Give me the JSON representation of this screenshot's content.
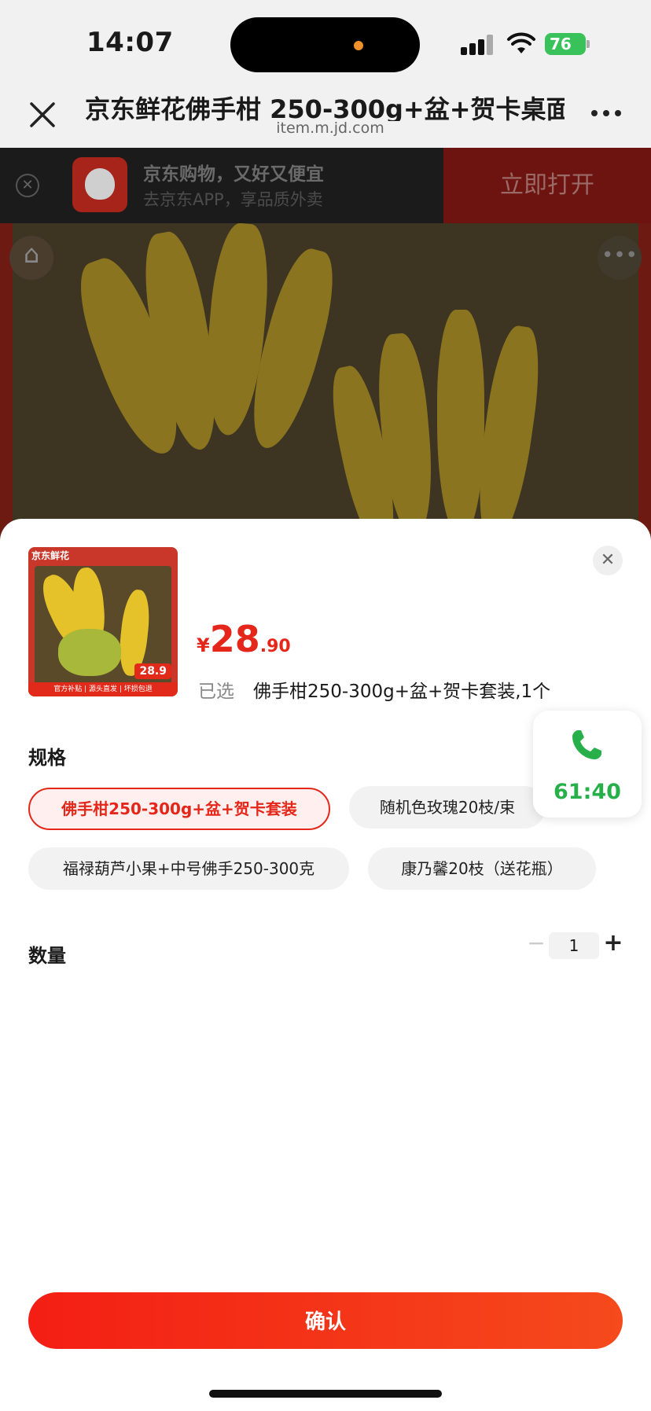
{
  "status_bar": {
    "time": "14:07",
    "battery": "76"
  },
  "browser": {
    "title": "京东鲜花佛手柑 250-300g+盆+贺卡桌面",
    "url": "item.m.jd.com"
  },
  "app_banner": {
    "title": "京东购物，又好又便宜",
    "subtitle": "去京东APP，享品质外卖",
    "open_label": "立即打开"
  },
  "product": {
    "thumb_brand": "京东鲜花",
    "thumb_price": "28.9",
    "thumb_footer": "官方补贴 | 源头直发 | 坏损包退",
    "price_currency": "¥",
    "price_int": "28",
    "price_dec": ".90",
    "selected_label": "已选",
    "selected_value": "佛手柑250-300g+盆+贺卡套装,1个"
  },
  "spec": {
    "title": "规格",
    "options": [
      {
        "label": "佛手柑250-300g+盆+贺卡套装",
        "selected": true
      },
      {
        "label": "随机色玫瑰20枝/束",
        "selected": false
      },
      {
        "label": "福禄葫芦小果+中号佛手250-300克",
        "selected": false
      },
      {
        "label": "康乃馨20枝（送花瓶）",
        "selected": false
      }
    ]
  },
  "quantity": {
    "title": "数量",
    "value": "1",
    "minus": "−",
    "plus": "+"
  },
  "call_widget": {
    "timer": "61:40",
    "color": "#27b04a"
  },
  "confirm_label": "确认",
  "colors": {
    "accent": "#e4271a",
    "button": "#f41e14"
  }
}
